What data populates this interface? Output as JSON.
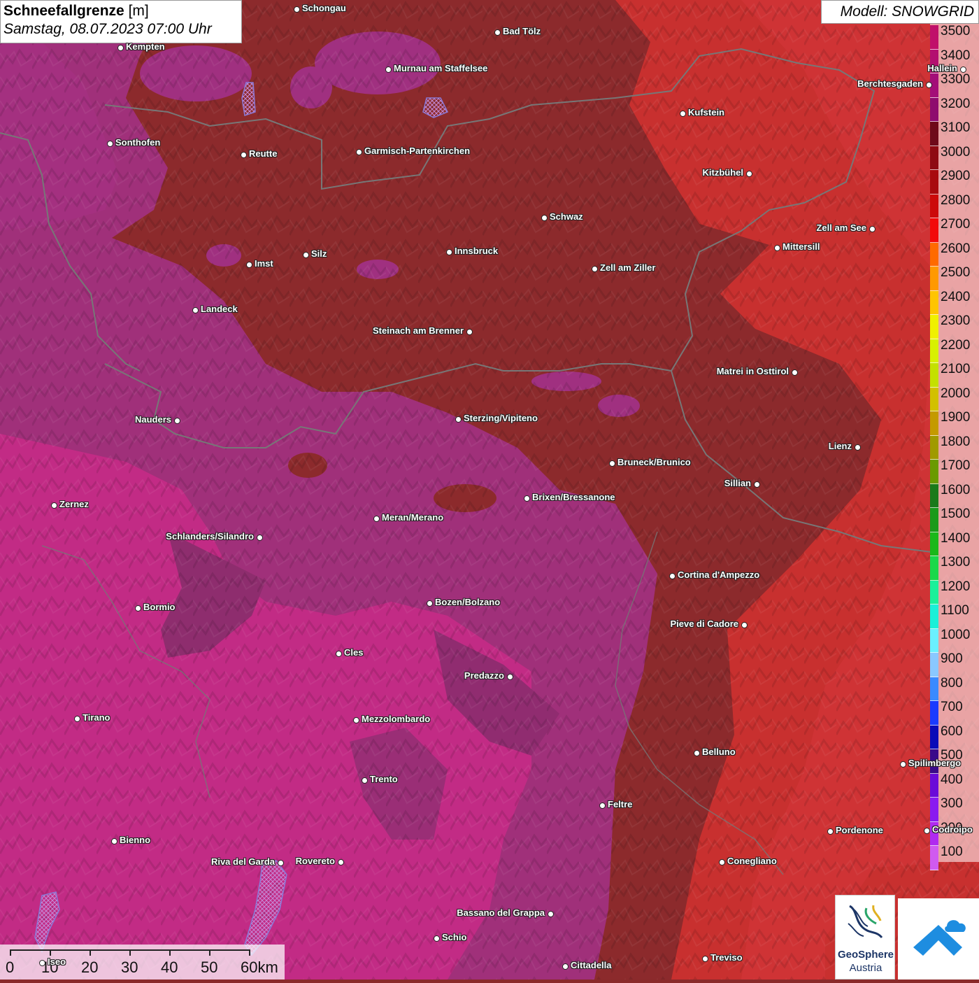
{
  "header": {
    "title_bold": "Schneefallgrenze",
    "title_unit": "[m]",
    "datetime": "Samstag, 08.07.2023 07:00 Uhr",
    "model": "Modell: SNOWGRID"
  },
  "legend": {
    "unit": "m",
    "levels": [
      {
        "value": "3500",
        "color": "#c0106a"
      },
      {
        "value": "3400",
        "color": "#b30f70"
      },
      {
        "value": "3300",
        "color": "#a30e78"
      },
      {
        "value": "3200",
        "color": "#8e0c6e"
      },
      {
        "value": "3100",
        "color": "#6e0a1a"
      },
      {
        "value": "3000",
        "color": "#8e0a12"
      },
      {
        "value": "2900",
        "color": "#a80a0e"
      },
      {
        "value": "2800",
        "color": "#cc0a0a"
      },
      {
        "value": "2700",
        "color": "#f20a0a"
      },
      {
        "value": "2600",
        "color": "#ff6a00"
      },
      {
        "value": "2500",
        "color": "#ff9900"
      },
      {
        "value": "2400",
        "color": "#ffc400"
      },
      {
        "value": "2300",
        "color": "#f0f000"
      },
      {
        "value": "2200",
        "color": "#d8f000"
      },
      {
        "value": "2100",
        "color": "#c4e000"
      },
      {
        "value": "2000",
        "color": "#d2c000"
      },
      {
        "value": "1900",
        "color": "#c49a00"
      },
      {
        "value": "1800",
        "color": "#a09a00"
      },
      {
        "value": "1700",
        "color": "#6a9a00"
      },
      {
        "value": "1600",
        "color": "#1a7a1a"
      },
      {
        "value": "1500",
        "color": "#1a9a1a"
      },
      {
        "value": "1400",
        "color": "#1ab81a"
      },
      {
        "value": "1300",
        "color": "#1ad84a"
      },
      {
        "value": "1200",
        "color": "#1af09a"
      },
      {
        "value": "1100",
        "color": "#1af0d8"
      },
      {
        "value": "1000",
        "color": "#6af0ff"
      },
      {
        "value": "900",
        "color": "#8ac8ff"
      },
      {
        "value": "800",
        "color": "#3a8aff"
      },
      {
        "value": "700",
        "color": "#1a3aff"
      },
      {
        "value": "600",
        "color": "#0a0ab8"
      },
      {
        "value": "500",
        "color": "#3a0a8a"
      },
      {
        "value": "400",
        "color": "#6a0ad8"
      },
      {
        "value": "300",
        "color": "#8a1af0"
      },
      {
        "value": "200",
        "color": "#b02af0"
      },
      {
        "value": "100",
        "color": "#d05af0"
      }
    ]
  },
  "scale": {
    "labels": [
      "0",
      "10",
      "20",
      "30",
      "40",
      "50",
      "60km"
    ]
  },
  "logos": {
    "geosphere_line1": "GeoSphere",
    "geosphere_line2": "Austria"
  },
  "cities": [
    {
      "name": "Schongau",
      "label_side": "right"
    },
    {
      "name": "Bad Tölz",
      "label_side": "right"
    },
    {
      "name": "Kempten",
      "label_side": "right"
    },
    {
      "name": "Murnau am Staffelsee",
      "label_side": "right"
    },
    {
      "name": "Hallein",
      "label_side": "left"
    },
    {
      "name": "Berchtesgaden",
      "label_side": "left"
    },
    {
      "name": "Kufstein",
      "label_side": "right"
    },
    {
      "name": "Sonthofen",
      "label_side": "right"
    },
    {
      "name": "Reutte",
      "label_side": "right"
    },
    {
      "name": "Garmisch-Partenkirchen",
      "label_side": "right"
    },
    {
      "name": "Kitzbühel",
      "label_side": "left"
    },
    {
      "name": "Schwaz",
      "label_side": "right"
    },
    {
      "name": "Zell am See",
      "label_side": "left"
    },
    {
      "name": "Innsbruck",
      "label_side": "right"
    },
    {
      "name": "Mittersill",
      "label_side": "right"
    },
    {
      "name": "Imst",
      "label_side": "right"
    },
    {
      "name": "Silz",
      "label_side": "right"
    },
    {
      "name": "Zell am Ziller",
      "label_side": "right"
    },
    {
      "name": "Landeck",
      "label_side": "right"
    },
    {
      "name": "Steinach am Brenner",
      "label_side": "left"
    },
    {
      "name": "Matrei in Osttirol",
      "label_side": "left"
    },
    {
      "name": "Nauders",
      "label_side": "left"
    },
    {
      "name": "Sterzing/Vipiteno",
      "label_side": "right"
    },
    {
      "name": "Lienz",
      "label_side": "left"
    },
    {
      "name": "Bruneck/Brunico",
      "label_side": "right"
    },
    {
      "name": "Sillian",
      "label_side": "left"
    },
    {
      "name": "Brixen/Bressanone",
      "label_side": "right"
    },
    {
      "name": "Zernez",
      "label_side": "right"
    },
    {
      "name": "Meran/Merano",
      "label_side": "right"
    },
    {
      "name": "Schlanders/Silandro",
      "label_side": "left"
    },
    {
      "name": "Cortina d'Ampezzo",
      "label_side": "right"
    },
    {
      "name": "Bozen/Bolzano",
      "label_side": "right"
    },
    {
      "name": "Bormio",
      "label_side": "right"
    },
    {
      "name": "Pieve di Cadore",
      "label_side": "left"
    },
    {
      "name": "Cles",
      "label_side": "right"
    },
    {
      "name": "Predazzo",
      "label_side": "left"
    },
    {
      "name": "Tirano",
      "label_side": "right"
    },
    {
      "name": "Mezzolombardo",
      "label_side": "right"
    },
    {
      "name": "Belluno",
      "label_side": "right"
    },
    {
      "name": "Spilimbergo",
      "label_side": "right"
    },
    {
      "name": "Trento",
      "label_side": "right"
    },
    {
      "name": "Feltre",
      "label_side": "right"
    },
    {
      "name": "Pordenone",
      "label_side": "right"
    },
    {
      "name": "Codroipo",
      "label_side": "right"
    },
    {
      "name": "Bienno",
      "label_side": "right"
    },
    {
      "name": "Riva del Garda",
      "label_side": "left"
    },
    {
      "name": "Rovereto",
      "label_side": "left"
    },
    {
      "name": "Conegliano",
      "label_side": "right"
    },
    {
      "name": "Bassano del Grappa",
      "label_side": "left"
    },
    {
      "name": "Schio",
      "label_side": "right"
    },
    {
      "name": "Treviso",
      "label_side": "right"
    },
    {
      "name": "Cittadella",
      "label_side": "right"
    },
    {
      "name": "Iseo",
      "label_side": "right"
    }
  ]
}
